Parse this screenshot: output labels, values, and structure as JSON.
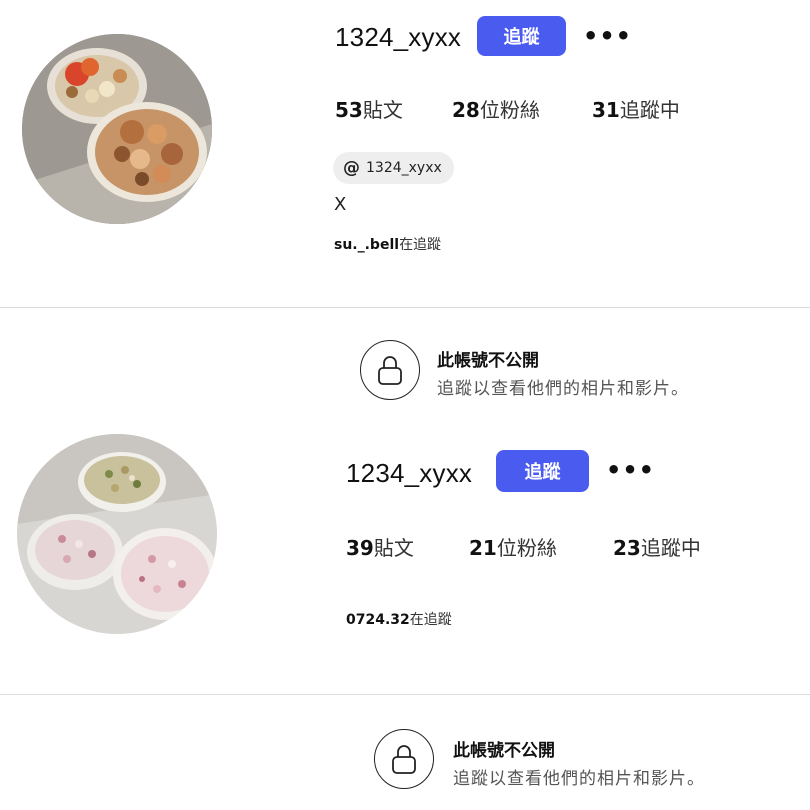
{
  "profiles": [
    {
      "username": "1324_xyxx",
      "follow_label": "追蹤",
      "more_label": "•••",
      "stats": {
        "posts_count": "53",
        "posts_label": "貼文",
        "followers_count": "28",
        "followers_label": "位粉絲",
        "following_count": "31",
        "following_label": "追蹤中"
      },
      "threads_handle": "1324_xyxx",
      "bio": "X",
      "followed_by_user": "su._.bell",
      "followed_by_suffix": "在追蹤"
    },
    {
      "username": "1234_xyxx",
      "follow_label": "追蹤",
      "more_label": "•••",
      "stats": {
        "posts_count": "39",
        "posts_label": "貼文",
        "followers_count": "21",
        "followers_label": "位粉絲",
        "following_count": "23",
        "following_label": "追蹤中"
      },
      "followed_by_user": "0724.32",
      "followed_by_suffix": "在追蹤"
    }
  ],
  "private_notice": {
    "title": "此帳號不公開",
    "subtitle": "追蹤以查看他們的相片和影片。"
  },
  "threads_icon_glyph": "@",
  "colors": {
    "follow_button": "#4a5cf0",
    "divider": "#dcdcdc"
  }
}
